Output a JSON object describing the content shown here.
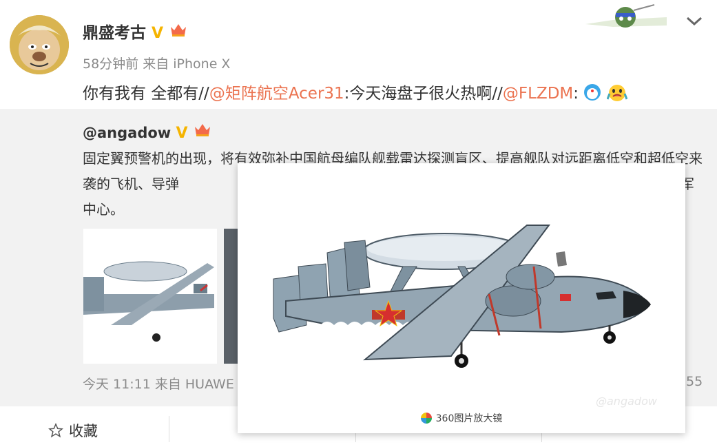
{
  "post": {
    "author": "鼎盛考古",
    "verified_badge": "V",
    "meta": "58分钟前 来自 iPhone X",
    "content": {
      "part1": "你有我有 全都有//",
      "mention1": "@矩阵航空Acer31",
      "part2": ":今天海盘子很火热啊//",
      "mention2": "@FLZDM",
      "part3": ":"
    }
  },
  "quoted": {
    "author": "@angadow",
    "verified_badge": "V",
    "text": "固定翼预警机的出现，将有效弥补中国航母编队舰载雷达探测盲区、提高舰队对远距离低空和超低空来袭的飞机、导弹",
    "text_tail": "军",
    "text_line3": "中心。",
    "meta": "今天 11:11 来自 HUAWE",
    "count": "55"
  },
  "popup": {
    "watermark": "@angadow",
    "footer_label": "360图片放大镜"
  },
  "actions": {
    "favorite_label": "收藏"
  },
  "colors": {
    "mention": "#eb7350",
    "verified": "#f5b400",
    "quoted_bg": "#f2f2f2"
  }
}
